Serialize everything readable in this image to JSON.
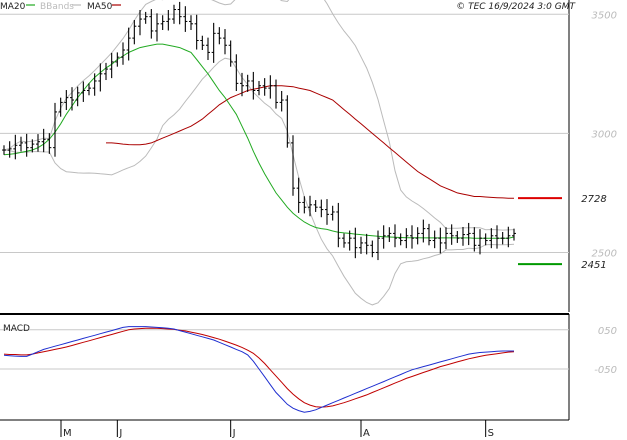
{
  "header": {
    "copyright": "© TEC 16/9/2024 3:0 GMT"
  },
  "legend": [
    {
      "label": "MA20",
      "color": "#22aa22",
      "swatch": "MA20"
    },
    {
      "label": "BBands",
      "color": "#bbbbbb",
      "swatch": "BBands"
    },
    {
      "label": "MA50",
      "color": "#aa0000",
      "swatch": "MA50"
    }
  ],
  "colors": {
    "background": "#ffffff",
    "price_bars": "#000000",
    "ma20": "#22aa22",
    "ma50": "#aa0000",
    "bbands": "#bbbbbb",
    "gridline": "#c8c8c8",
    "macd_line": "#1f2fd0",
    "signal_line": "#c00000",
    "resistance_marker": "#dd0000",
    "support_marker": "#009900"
  },
  "macd_panel": {
    "title": "MACD"
  },
  "chart_data": [
    {
      "type": "ohlc",
      "title": "",
      "ylim": [
        2250,
        3560
      ],
      "y_ticks": [
        2500,
        3000,
        3500
      ],
      "grid": true,
      "x_tick_labels": [
        {
          "label": "M",
          "index": 0
        },
        {
          "label": "J",
          "index": 20
        },
        {
          "label": "J",
          "index": 40
        },
        {
          "label": "A",
          "index": 63
        },
        {
          "label": "S",
          "index": 85
        }
      ],
      "markers": [
        {
          "label": "2728",
          "value": 2728,
          "color": "#dd0000"
        },
        {
          "label": "2451",
          "value": 2451,
          "color": "#009900"
        }
      ],
      "closes": [
        2930,
        2935,
        2950,
        2960,
        2940,
        2955,
        2965,
        2975,
        2940,
        3090,
        3130,
        3150,
        3140,
        3170,
        3180,
        3190,
        3220,
        3250,
        3270,
        3300,
        3320,
        3350,
        3400,
        3450,
        3480,
        3490,
        3430,
        3460,
        3470,
        3480,
        3520,
        3490,
        3470,
        3460,
        3390,
        3370,
        3340,
        3420,
        3400,
        3370,
        3300,
        3210,
        3200,
        3220,
        3180,
        3200,
        3190,
        3200,
        3130,
        3140,
        2960,
        2770,
        2710,
        2690,
        2700,
        2690,
        2680,
        2660,
        2670,
        2560,
        2540,
        2560,
        2520,
        2540,
        2530,
        2500,
        2560,
        2570,
        2580,
        2560,
        2550,
        2570,
        2560,
        2580,
        2600,
        2550,
        2560,
        2540,
        2580,
        2570,
        2560,
        2575,
        2580,
        2530,
        2560,
        2550,
        2570,
        2560,
        2560,
        2570,
        2580
      ],
      "series": [
        {
          "name": "MA20",
          "values": [
            2910,
            2912,
            2915,
            2920,
            2925,
            2930,
            2940,
            2955,
            2975,
            3005,
            3040,
            3080,
            3115,
            3150,
            3180,
            3210,
            3235,
            3255,
            3275,
            3290,
            3310,
            3325,
            3340,
            3350,
            3360,
            3365,
            3370,
            3375,
            3375,
            3370,
            3365,
            3360,
            3350,
            3340,
            3310,
            3280,
            3250,
            3215,
            3180,
            3150,
            3115,
            3080,
            3030,
            2980,
            2925,
            2875,
            2830,
            2790,
            2750,
            2720,
            2690,
            2665,
            2645,
            2628,
            2615,
            2605,
            2600,
            2597,
            2590,
            2585,
            2582,
            2580,
            2577,
            2575,
            2572,
            2570,
            2568,
            2566,
            2565,
            2564,
            2563,
            2562,
            2562,
            2562,
            2561,
            2561,
            2561,
            2561,
            2561,
            2561,
            2561,
            2561,
            2561,
            2560,
            2560,
            2560,
            2560,
            2560,
            2560,
            2560,
            2565
          ]
        },
        {
          "name": "MA50",
          "values": [
            2960,
            2960,
            2958,
            2955,
            2953,
            2952,
            2952,
            2955,
            2960,
            2970,
            2980,
            2990,
            3000,
            3010,
            3020,
            3030,
            3045,
            3060,
            3080,
            3100,
            3120,
            3135,
            3150,
            3160,
            3170,
            3180,
            3185,
            3190,
            3195,
            3200,
            3200,
            3200,
            3198,
            3196,
            3190,
            3185,
            3180,
            3170,
            3160,
            3150,
            3140,
            3120,
            3100,
            3080,
            3060,
            3040,
            3020,
            3000,
            2980,
            2960,
            2940,
            2920,
            2900,
            2880,
            2860,
            2840,
            2825,
            2810,
            2795,
            2780,
            2770,
            2760,
            2750,
            2745,
            2740,
            2735,
            2735,
            2733,
            2731,
            2730,
            2729,
            2728,
            2728
          ]
        },
        {
          "name": "MACD",
          "values": [
            -15,
            -16,
            -17,
            -18,
            -18,
            -12,
            -6,
            0,
            4,
            8,
            12,
            16,
            20,
            24,
            28,
            32,
            36,
            40,
            44,
            48,
            52,
            56,
            58,
            58,
            58,
            58,
            57,
            56,
            55,
            54,
            52,
            48,
            44,
            40,
            36,
            32,
            28,
            24,
            18,
            12,
            6,
            0,
            -6,
            -14,
            -30,
            -50,
            -70,
            -90,
            -110,
            -125,
            -140,
            -150,
            -156,
            -160,
            -158,
            -154,
            -148,
            -142,
            -136,
            -130,
            -124,
            -118,
            -112,
            -106,
            -100,
            -94,
            -88,
            -82,
            -76,
            -70,
            -64,
            -58,
            -52,
            -48,
            -44,
            -40,
            -36,
            -32,
            -28,
            -24,
            -20,
            -16,
            -12,
            -10,
            -8,
            -7,
            -6,
            -5,
            -4,
            -4,
            -4
          ]
        },
        {
          "name": "Signal",
          "values": [
            -12,
            -13,
            -13,
            -14,
            -14,
            -12,
            -9,
            -6,
            -3,
            0,
            3,
            6,
            10,
            14,
            18,
            22,
            26,
            30,
            34,
            38,
            42,
            46,
            50,
            52,
            53,
            54,
            54,
            54,
            53,
            52,
            51,
            49,
            47,
            44,
            41,
            38,
            34,
            30,
            26,
            21,
            16,
            11,
            5,
            -2,
            -10,
            -22,
            -36,
            -52,
            -68,
            -84,
            -100,
            -114,
            -126,
            -136,
            -142,
            -146,
            -147,
            -146,
            -144,
            -140,
            -136,
            -131,
            -126,
            -121,
            -116,
            -110,
            -104,
            -98,
            -92,
            -86,
            -80,
            -74,
            -69,
            -64,
            -59,
            -54,
            -49,
            -44,
            -40,
            -36,
            -32,
            -28,
            -24,
            -21,
            -18,
            -15,
            -13,
            -11,
            -9,
            -7,
            -6
          ]
        }
      ]
    },
    {
      "type": "line",
      "title": "MACD",
      "ylim": [
        -180,
        80
      ],
      "y_ticks": [
        {
          "label": "050",
          "value": 50
        },
        {
          "label": "-050",
          "value": -50
        }
      ],
      "series_names": [
        "MACD",
        "Signal"
      ]
    }
  ]
}
